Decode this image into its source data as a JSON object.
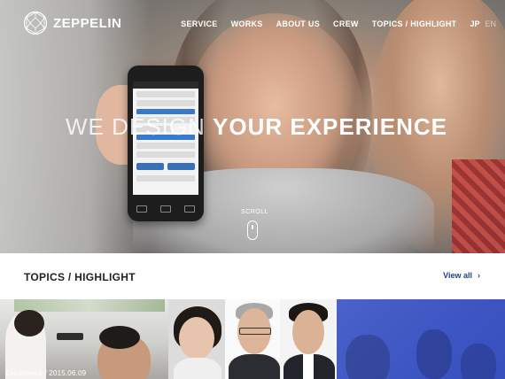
{
  "brand": {
    "name": "ZEPPELIN"
  },
  "nav": {
    "items": [
      "SERVICE",
      "WORKS",
      "ABOUT US",
      "CREW",
      "TOPICS / HIGHLIGHT"
    ],
    "lang_active": "JP",
    "lang_inactive": "EN"
  },
  "hero": {
    "headline_light": "WE DESIGN ",
    "headline_bold": "YOUR EXPERIENCE",
    "scroll_label": "SCROLL"
  },
  "topics": {
    "title": "TOPICS / HIGHLIGHT",
    "view_all": "View all",
    "first_caption": "Experience / 2015.06.09"
  },
  "colors": {
    "accent_blue": "#1c3f8f",
    "tile_overlay": "#3c55c2"
  },
  "icons": {
    "logo": "geodesic-sphere-icon",
    "scroll": "mouse-icon",
    "view_all": "chevron-right-icon"
  }
}
